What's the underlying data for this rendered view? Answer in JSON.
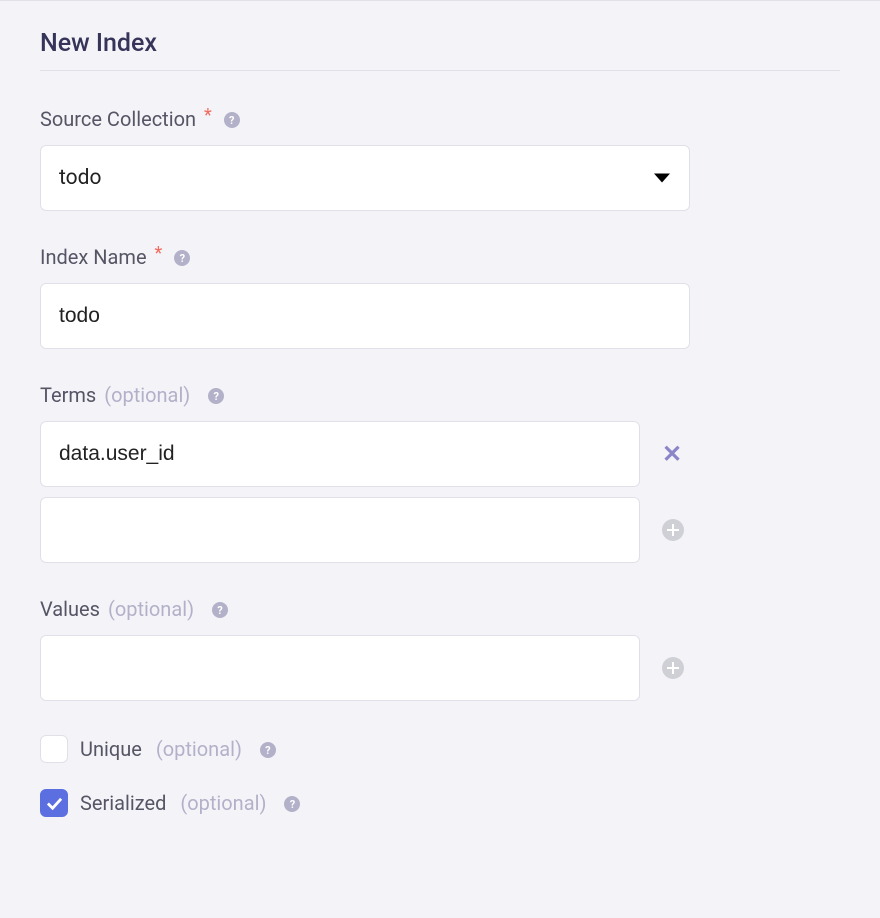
{
  "panel": {
    "title": "New Index"
  },
  "labels": {
    "source_collection": "Source Collection",
    "index_name": "Index Name",
    "terms": "Terms",
    "values": "Values",
    "optional": "(optional)",
    "unique": "Unique",
    "serialized": "Serialized"
  },
  "fields": {
    "source_collection_value": "todo",
    "index_name_value": "todo",
    "term_rows": [
      "data.user_id",
      ""
    ],
    "value_rows": [
      ""
    ]
  },
  "checkboxes": {
    "unique_checked": false,
    "serialized_checked": true
  }
}
